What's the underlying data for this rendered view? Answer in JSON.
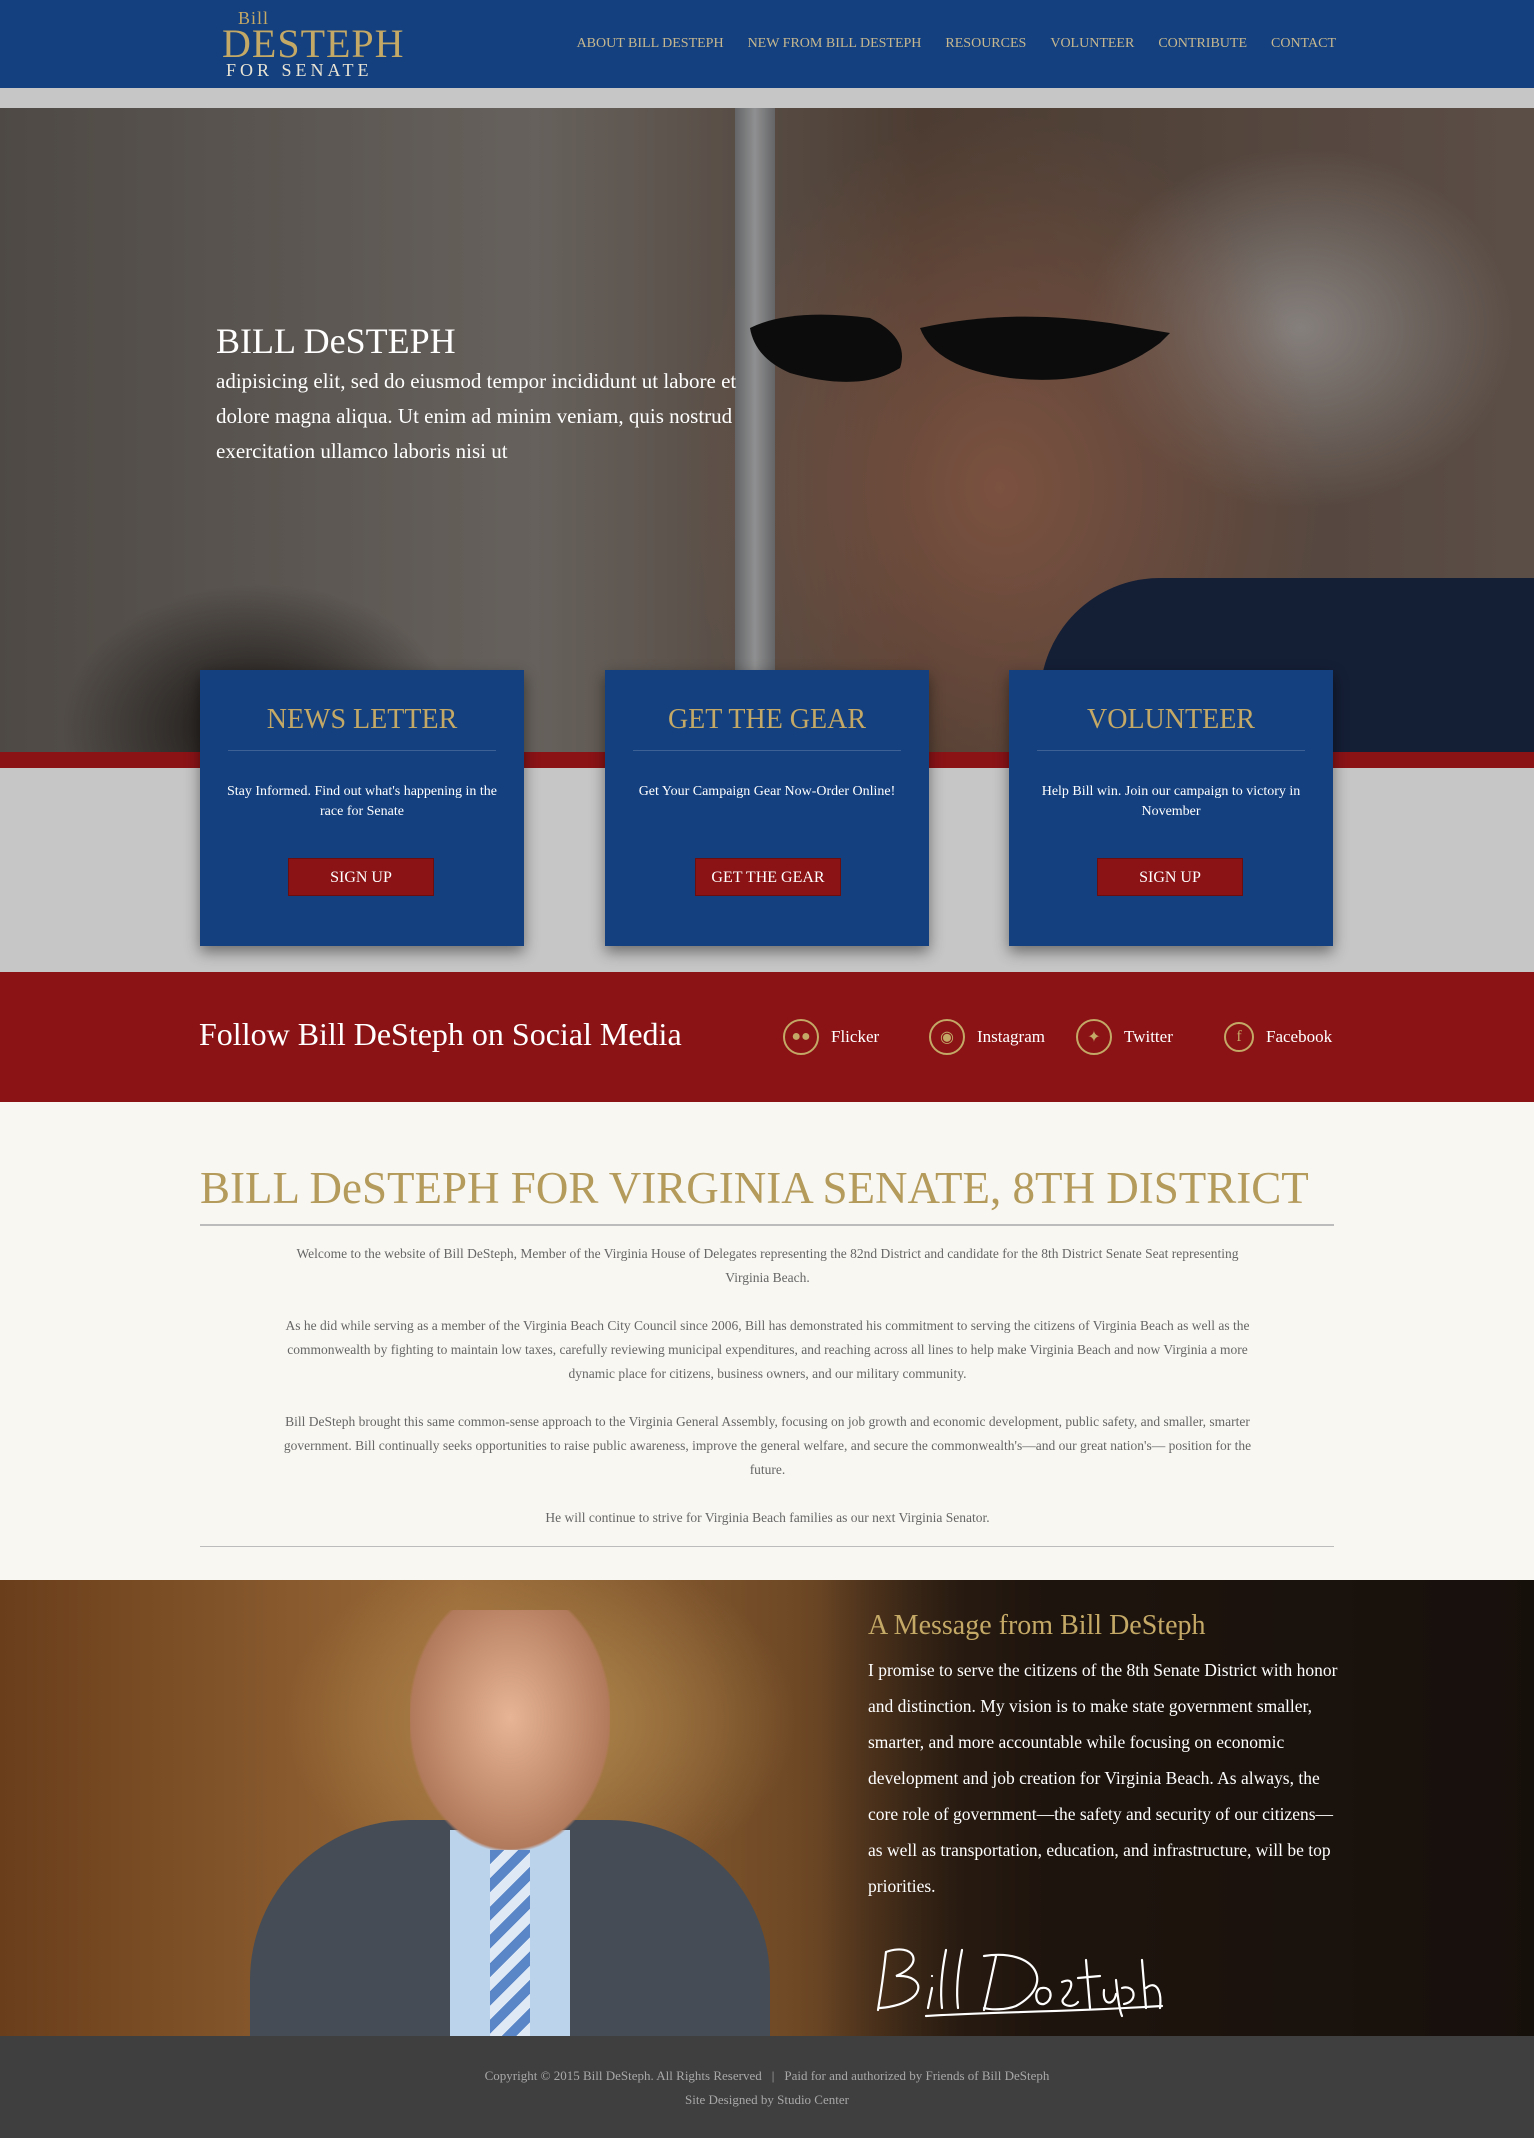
{
  "logo": {
    "line1": "Bill",
    "line2": "DESTEPH",
    "line3": "FOR SENATE"
  },
  "nav": {
    "items": [
      "ABOUT BILL DESTEPH",
      "NEW FROM BILL DESTEPH",
      "RESOURCES",
      "VOLUNTEER",
      "CONTRIBUTE",
      "CONTACT"
    ]
  },
  "hero": {
    "title": "BILL DeSTEPH",
    "text": "adipisicing elit, sed do eiusmod tempor incididunt ut labore et dolore magna aliqua. Ut enim ad minim veniam, quis nostrud exercitation ullamco laboris nisi ut"
  },
  "cards": [
    {
      "title": "NEWS LETTER",
      "text": "Stay Informed. Find out what's happening in the race for Senate",
      "button": "SIGN UP"
    },
    {
      "title": "GET THE GEAR",
      "text": "Get Your Campaign Gear Now-Order Online!",
      "button": "GET THE GEAR"
    },
    {
      "title": "VOLUNTEER",
      "text": "Help Bill win. Join our campaign to victory in November",
      "button": "SIGN UP"
    }
  ],
  "social": {
    "title": "Follow Bill DeSteph on Social Media",
    "links": [
      {
        "label": "Flicker",
        "icon": "flickr-icon"
      },
      {
        "label": "Instagram",
        "icon": "instagram-icon"
      },
      {
        "label": "Twitter",
        "icon": "twitter-icon"
      },
      {
        "label": "Facebook",
        "icon": "facebook-icon"
      }
    ]
  },
  "about": {
    "title": "BILL DeSTEPH FOR VIRGINIA SENATE, 8TH DISTRICT",
    "paragraphs": [
      "Welcome to the website of Bill DeSteph, Member of the Virginia House of Delegates representing the 82nd District and candidate for the 8th District Senate Seat representing Virginia Beach.",
      "As he did while serving as a member of the Virginia Beach City Council since 2006, Bill has demonstrated his commitment to serving the citizens of Virginia Beach as well as the commonwealth by fighting to maintain low taxes, carefully reviewing municipal expenditures, and reaching across all lines to help make Virginia Beach and now Virginia a more dynamic place for citizens, business owners, and our military community.",
      "Bill DeSteph brought this same common-sense approach to the Virginia General Assembly, focusing on job growth and economic development, public safety, and smaller, smarter government. Bill continually seeks opportunities to raise public awareness, improve the general welfare, and secure the commonwealth's—and our great nation's— position for the future.",
      "He will continue to strive for Virginia Beach families as our next Virginia Senator."
    ]
  },
  "message": {
    "title": "A Message from Bill DeSteph",
    "text": "I promise to serve the citizens of the 8th Senate District with honor and distinction. My vision is to make state government smaller, smarter, and more accountable while focusing on economic development and job creation for Virginia Beach. As always, the core role of government—the safety and security of our citizens—as well as transportation, education, and infrastructure, will be top priorities.",
    "signature": "Bill DeSteph"
  },
  "footer": {
    "copyright": "Copyright © 2015 Bill DeSteph. All Rights Reserved",
    "separator": "|",
    "paid_for": "Paid for and authorized by Friends of Bill DeSteph",
    "designed_by": "Site Designed by Studio Center"
  },
  "colors": {
    "navy": "#14407f",
    "gold": "#c3a866",
    "red": "#8b1316",
    "footer": "#3f3f3f"
  }
}
